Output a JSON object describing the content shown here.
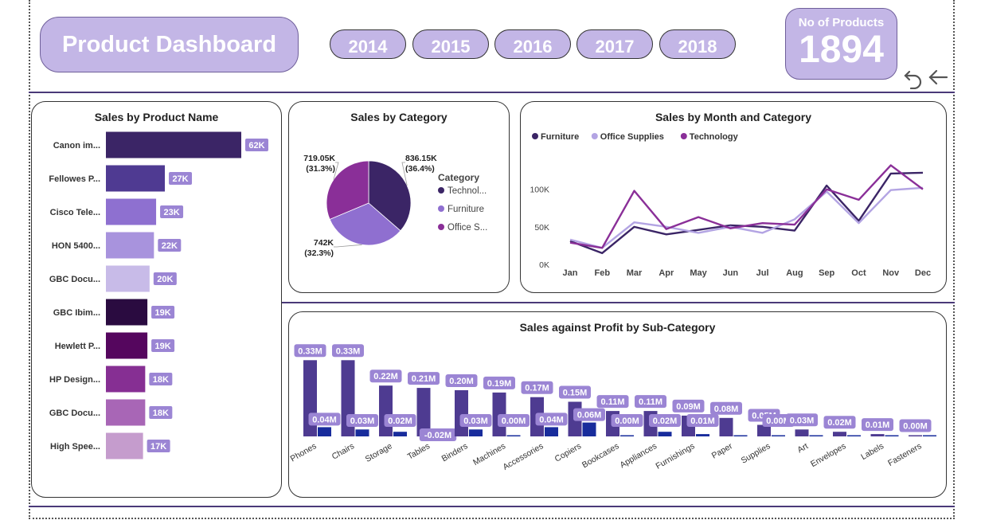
{
  "header": {
    "title": "Product Dashboard",
    "years": [
      "2014",
      "2015",
      "2016",
      "2017",
      "2018"
    ],
    "card_label": "No of Products",
    "card_value": "1894"
  },
  "colors": {
    "accent": "#c3b6e6",
    "dark_purple": "#3b2566",
    "furniture": "#3b2566",
    "office_supplies": "#b3a4e3",
    "technology": "#8a2f98",
    "sales_bar": "#4e3b91",
    "profit_bar": "#182c9c",
    "label_bg": "#9b85d4"
  },
  "chart_data": [
    {
      "type": "bar",
      "orientation": "horizontal",
      "title": "Sales by Product Name",
      "categories": [
        "Canon im...",
        "Fellowes P...",
        "Cisco Tele...",
        "HON 5400...",
        "GBC Docu...",
        "GBC Ibim...",
        "Hewlett P...",
        "HP Design...",
        "GBC Docu...",
        "High Spee..."
      ],
      "values": [
        62,
        27,
        23,
        22,
        20,
        19,
        19,
        18,
        18,
        17
      ],
      "labels": [
        "62K",
        "27K",
        "23K",
        "22K",
        "20K",
        "19K",
        "19K",
        "18K",
        "18K",
        "17K"
      ],
      "bar_colors": [
        "#3b2566",
        "#4f3a92",
        "#8e70d0",
        "#a893dd",
        "#c8bbe8",
        "#2a0b40",
        "#55065e",
        "#862f93",
        "#a866b6",
        "#c59ccd"
      ]
    },
    {
      "type": "pie",
      "title": "Sales by Category",
      "legend_title": "Category",
      "slices": [
        {
          "name": "Technol...",
          "value": 836.15,
          "label": "836.15K",
          "pct": "(36.4%)",
          "color": "#3b2566"
        },
        {
          "name": "Furniture",
          "value": 742,
          "label": "742K",
          "pct": "(32.3%)",
          "color": "#8f6fd0"
        },
        {
          "name": "Office S...",
          "value": 719.05,
          "label": "719.05K",
          "pct": "(31.3%)",
          "color": "#8a2f98"
        }
      ]
    },
    {
      "type": "line",
      "title": "Sales by Month and Category",
      "x": [
        "Jan",
        "Feb",
        "Mar",
        "Apr",
        "May",
        "Jun",
        "Jul",
        "Aug",
        "Sep",
        "Oct",
        "Nov",
        "Dec"
      ],
      "ylim": [
        0,
        140
      ],
      "yticks": [
        0,
        50,
        100
      ],
      "ytick_labels": [
        "0K",
        "50K",
        "100K"
      ],
      "series": [
        {
          "name": "Furniture",
          "color": "#3b2566",
          "values": [
            31,
            15,
            50,
            40,
            46,
            52,
            50,
            45,
            105,
            58,
            121,
            122
          ]
        },
        {
          "name": "Office Supplies",
          "color": "#b3a4e3",
          "values": [
            33,
            22,
            56,
            50,
            42,
            50,
            42,
            60,
            97,
            55,
            99,
            102
          ]
        },
        {
          "name": "Technology",
          "color": "#8a2f98",
          "values": [
            29,
            22,
            98,
            47,
            63,
            48,
            55,
            53,
            100,
            86,
            132,
            100
          ]
        }
      ]
    },
    {
      "type": "bar",
      "title": "Sales against Profit by Sub-Category",
      "categories": [
        "Phones",
        "Chairs",
        "Storage",
        "Tables",
        "Binders",
        "Machines",
        "Accessories",
        "Copiers",
        "Bookcases",
        "Appliances",
        "Furnishings",
        "Paper",
        "Supplies",
        "Art",
        "Envelopes",
        "Labels",
        "Fasteners"
      ],
      "series": [
        {
          "name": "Sales",
          "values": [
            0.33,
            0.33,
            0.22,
            0.21,
            0.2,
            0.19,
            0.17,
            0.15,
            0.11,
            0.11,
            0.09,
            0.08,
            0.05,
            0.03,
            0.02,
            0.01,
            0.0
          ],
          "labels": [
            "0.33M",
            "0.33M",
            "0.22M",
            "0.21M",
            "0.20M",
            "0.19M",
            "0.17M",
            "0.15M",
            "0.11M",
            "0.11M",
            "0.09M",
            "0.08M",
            "0.05M",
            "0.03M",
            "0.02M",
            "0.01M",
            "0.00M"
          ]
        },
        {
          "name": "Profit",
          "values": [
            0.04,
            0.03,
            0.02,
            -0.02,
            0.03,
            0.0,
            0.04,
            0.06,
            0.0,
            0.02,
            0.01,
            0.0,
            0.0,
            0.0,
            0.0,
            0.0,
            0.0
          ],
          "labels": [
            "0.04M",
            "0.03M",
            "0.02M",
            "-0.02M",
            "0.03M",
            "0.00M",
            "0.04M",
            "0.06M",
            "0.00M",
            "0.02M",
            "0.01M",
            "",
            "0.00M",
            "",
            "",
            "",
            ""
          ]
        }
      ]
    }
  ]
}
